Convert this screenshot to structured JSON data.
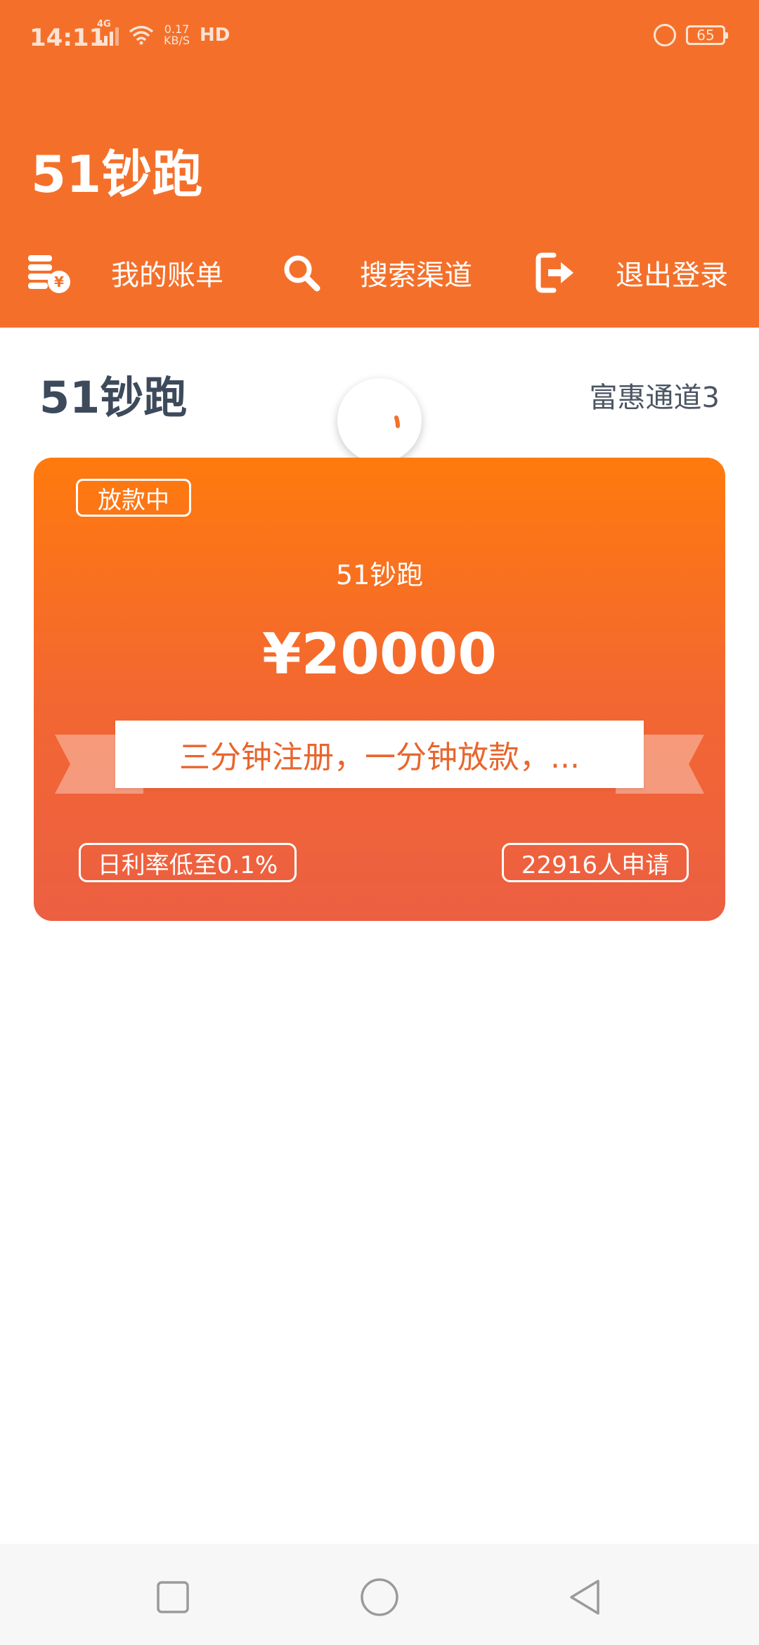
{
  "status_bar": {
    "time": "14:11",
    "network": "4G",
    "speed_value": "0.17",
    "speed_unit": "KB/S",
    "hd": "HD",
    "battery": "65"
  },
  "header": {
    "title": "51钞跑",
    "nav": [
      {
        "label": "我的账单",
        "icon": "bill-coins-icon"
      },
      {
        "label": "搜索渠道",
        "icon": "search-icon"
      },
      {
        "label": "退出登录",
        "icon": "logout-icon"
      }
    ]
  },
  "section": {
    "title": "51钞跑",
    "channel": "富惠通道3"
  },
  "card": {
    "status": "放款中",
    "name": "51钞跑",
    "amount": "¥20000",
    "slogan": "三分钟注册，一分钟放款，...",
    "rate": "日利率低至0.1%",
    "applicants": "22916人申请"
  },
  "colors": {
    "brand": "#F4702A",
    "card_top": "#FF7A0E",
    "card_bottom": "#EC5F42",
    "section_title": "#3d4a5c"
  }
}
